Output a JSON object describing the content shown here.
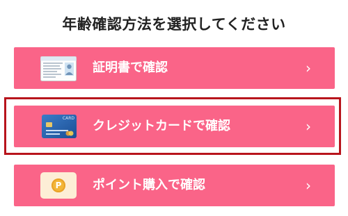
{
  "page": {
    "title": "年齢確認方法を選択してください"
  },
  "options": [
    {
      "label": "証明書で確認",
      "chevron": "›",
      "icon": "id-card-icon"
    },
    {
      "label": "クレジットカードで確認",
      "chevron": "›",
      "icon": "credit-card-icon"
    },
    {
      "label": "ポイント購入で確認",
      "chevron": "›",
      "icon": "point-coin-icon"
    }
  ],
  "credit_card": {
    "brand_text": "CARD"
  },
  "point_coin": {
    "letter": "P"
  },
  "colors": {
    "button_bg": "#fa6488",
    "button_text": "#ffffff",
    "selection_border": "#b8141c",
    "title_text": "#222222"
  }
}
